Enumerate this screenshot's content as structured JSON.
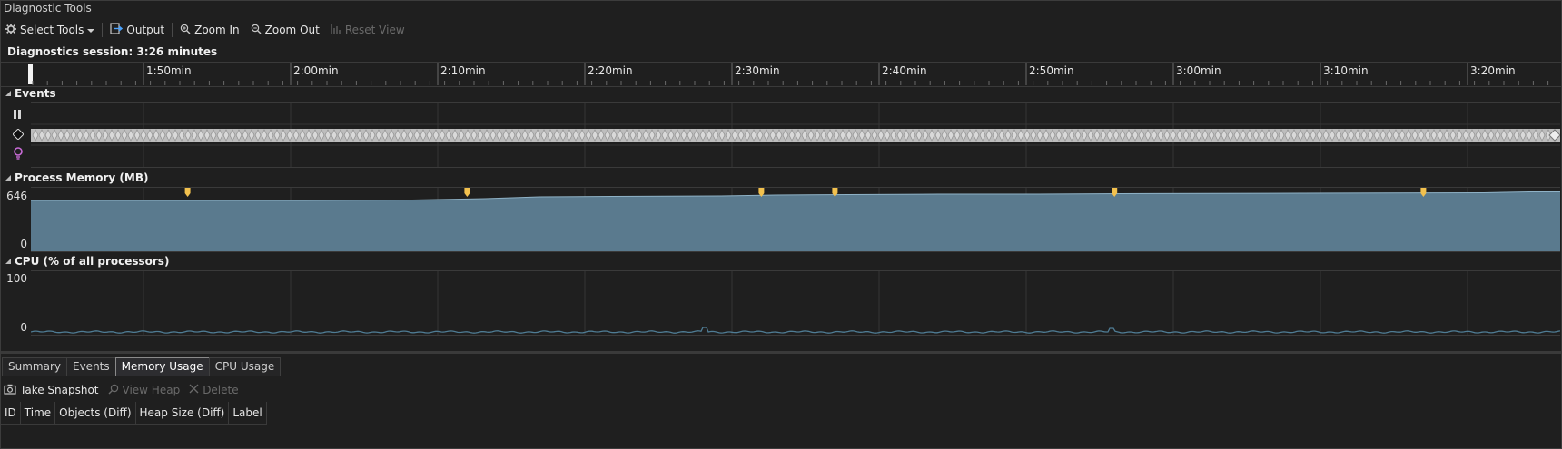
{
  "window": {
    "title": "Diagnostic Tools"
  },
  "toolbar": {
    "select_tools": "Select Tools",
    "output": "Output",
    "zoom_in": "Zoom In",
    "zoom_out": "Zoom Out",
    "reset_view": "Reset View"
  },
  "session": {
    "label": "Diagnostics session: 3:26 minutes"
  },
  "ruler": {
    "ticks": [
      "1:50min",
      "2:00min",
      "2:10min",
      "2:20min",
      "2:30min",
      "2:40min",
      "2:50min",
      "3:00min",
      "3:10min",
      "3:20min"
    ]
  },
  "events": {
    "header": "Events"
  },
  "memory": {
    "header": "Process Memory (MB)",
    "max_label": "646",
    "min_label": "0",
    "fill_color": "#5a7a8e",
    "snapshot_marker_color": "#f2c14e",
    "snapshot_markers_at": [
      "1:53min",
      "2:12min",
      "2:32min",
      "2:37min",
      "2:56min",
      "3:17min"
    ]
  },
  "cpu": {
    "header": "CPU (% of all processors)",
    "max_label": "100",
    "min_label": "0",
    "line_color": "#4f7c94"
  },
  "tabs": [
    "Summary",
    "Events",
    "Memory Usage",
    "CPU Usage"
  ],
  "active_tab": "Memory Usage",
  "commands": {
    "take_snapshot": "Take Snapshot",
    "view_heap": "View Heap",
    "delete": "Delete"
  },
  "table": {
    "columns": [
      "ID",
      "Time",
      "Objects (Diff)",
      "Heap Size (Diff)",
      "Label"
    ]
  }
}
